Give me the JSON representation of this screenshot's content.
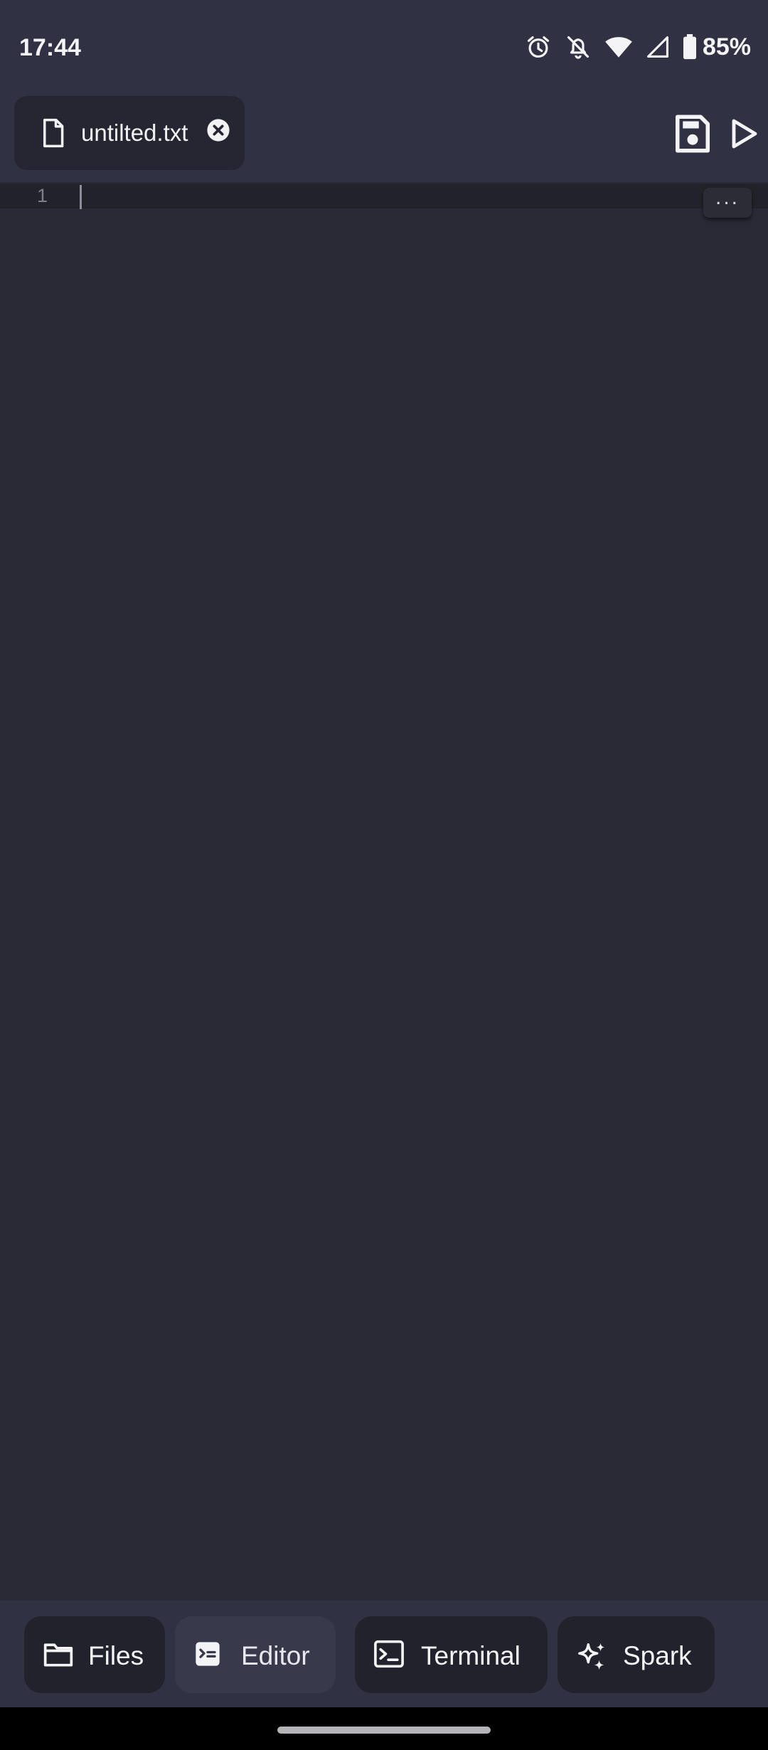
{
  "status_bar": {
    "time": "17:44",
    "battery_percent": "85%",
    "icons": [
      "alarm-icon",
      "notifications-off-icon",
      "wifi-icon",
      "cellular-signal-icon",
      "battery-icon"
    ]
  },
  "header": {
    "tab": {
      "filename": "untilted.txt",
      "file_icon": "document-icon",
      "close_icon": "close-circle-icon"
    },
    "actions": [
      {
        "name": "save",
        "icon": "save-icon"
      },
      {
        "name": "run",
        "icon": "play-icon"
      }
    ]
  },
  "editor": {
    "line_numbers": [
      "1"
    ],
    "content": "",
    "more_label": "..."
  },
  "bottom_nav": {
    "active": "Editor",
    "items": [
      {
        "label": "Files",
        "icon": "folder-icon"
      },
      {
        "label": "Editor",
        "icon": "editor-icon"
      },
      {
        "label": "Terminal",
        "icon": "terminal-icon"
      },
      {
        "label": "Spark",
        "icon": "sparkle-icon"
      }
    ]
  },
  "colors": {
    "background": "#292a36",
    "bars": "#303243",
    "tab_background": "#252631",
    "active_nav": "#383a4c"
  }
}
